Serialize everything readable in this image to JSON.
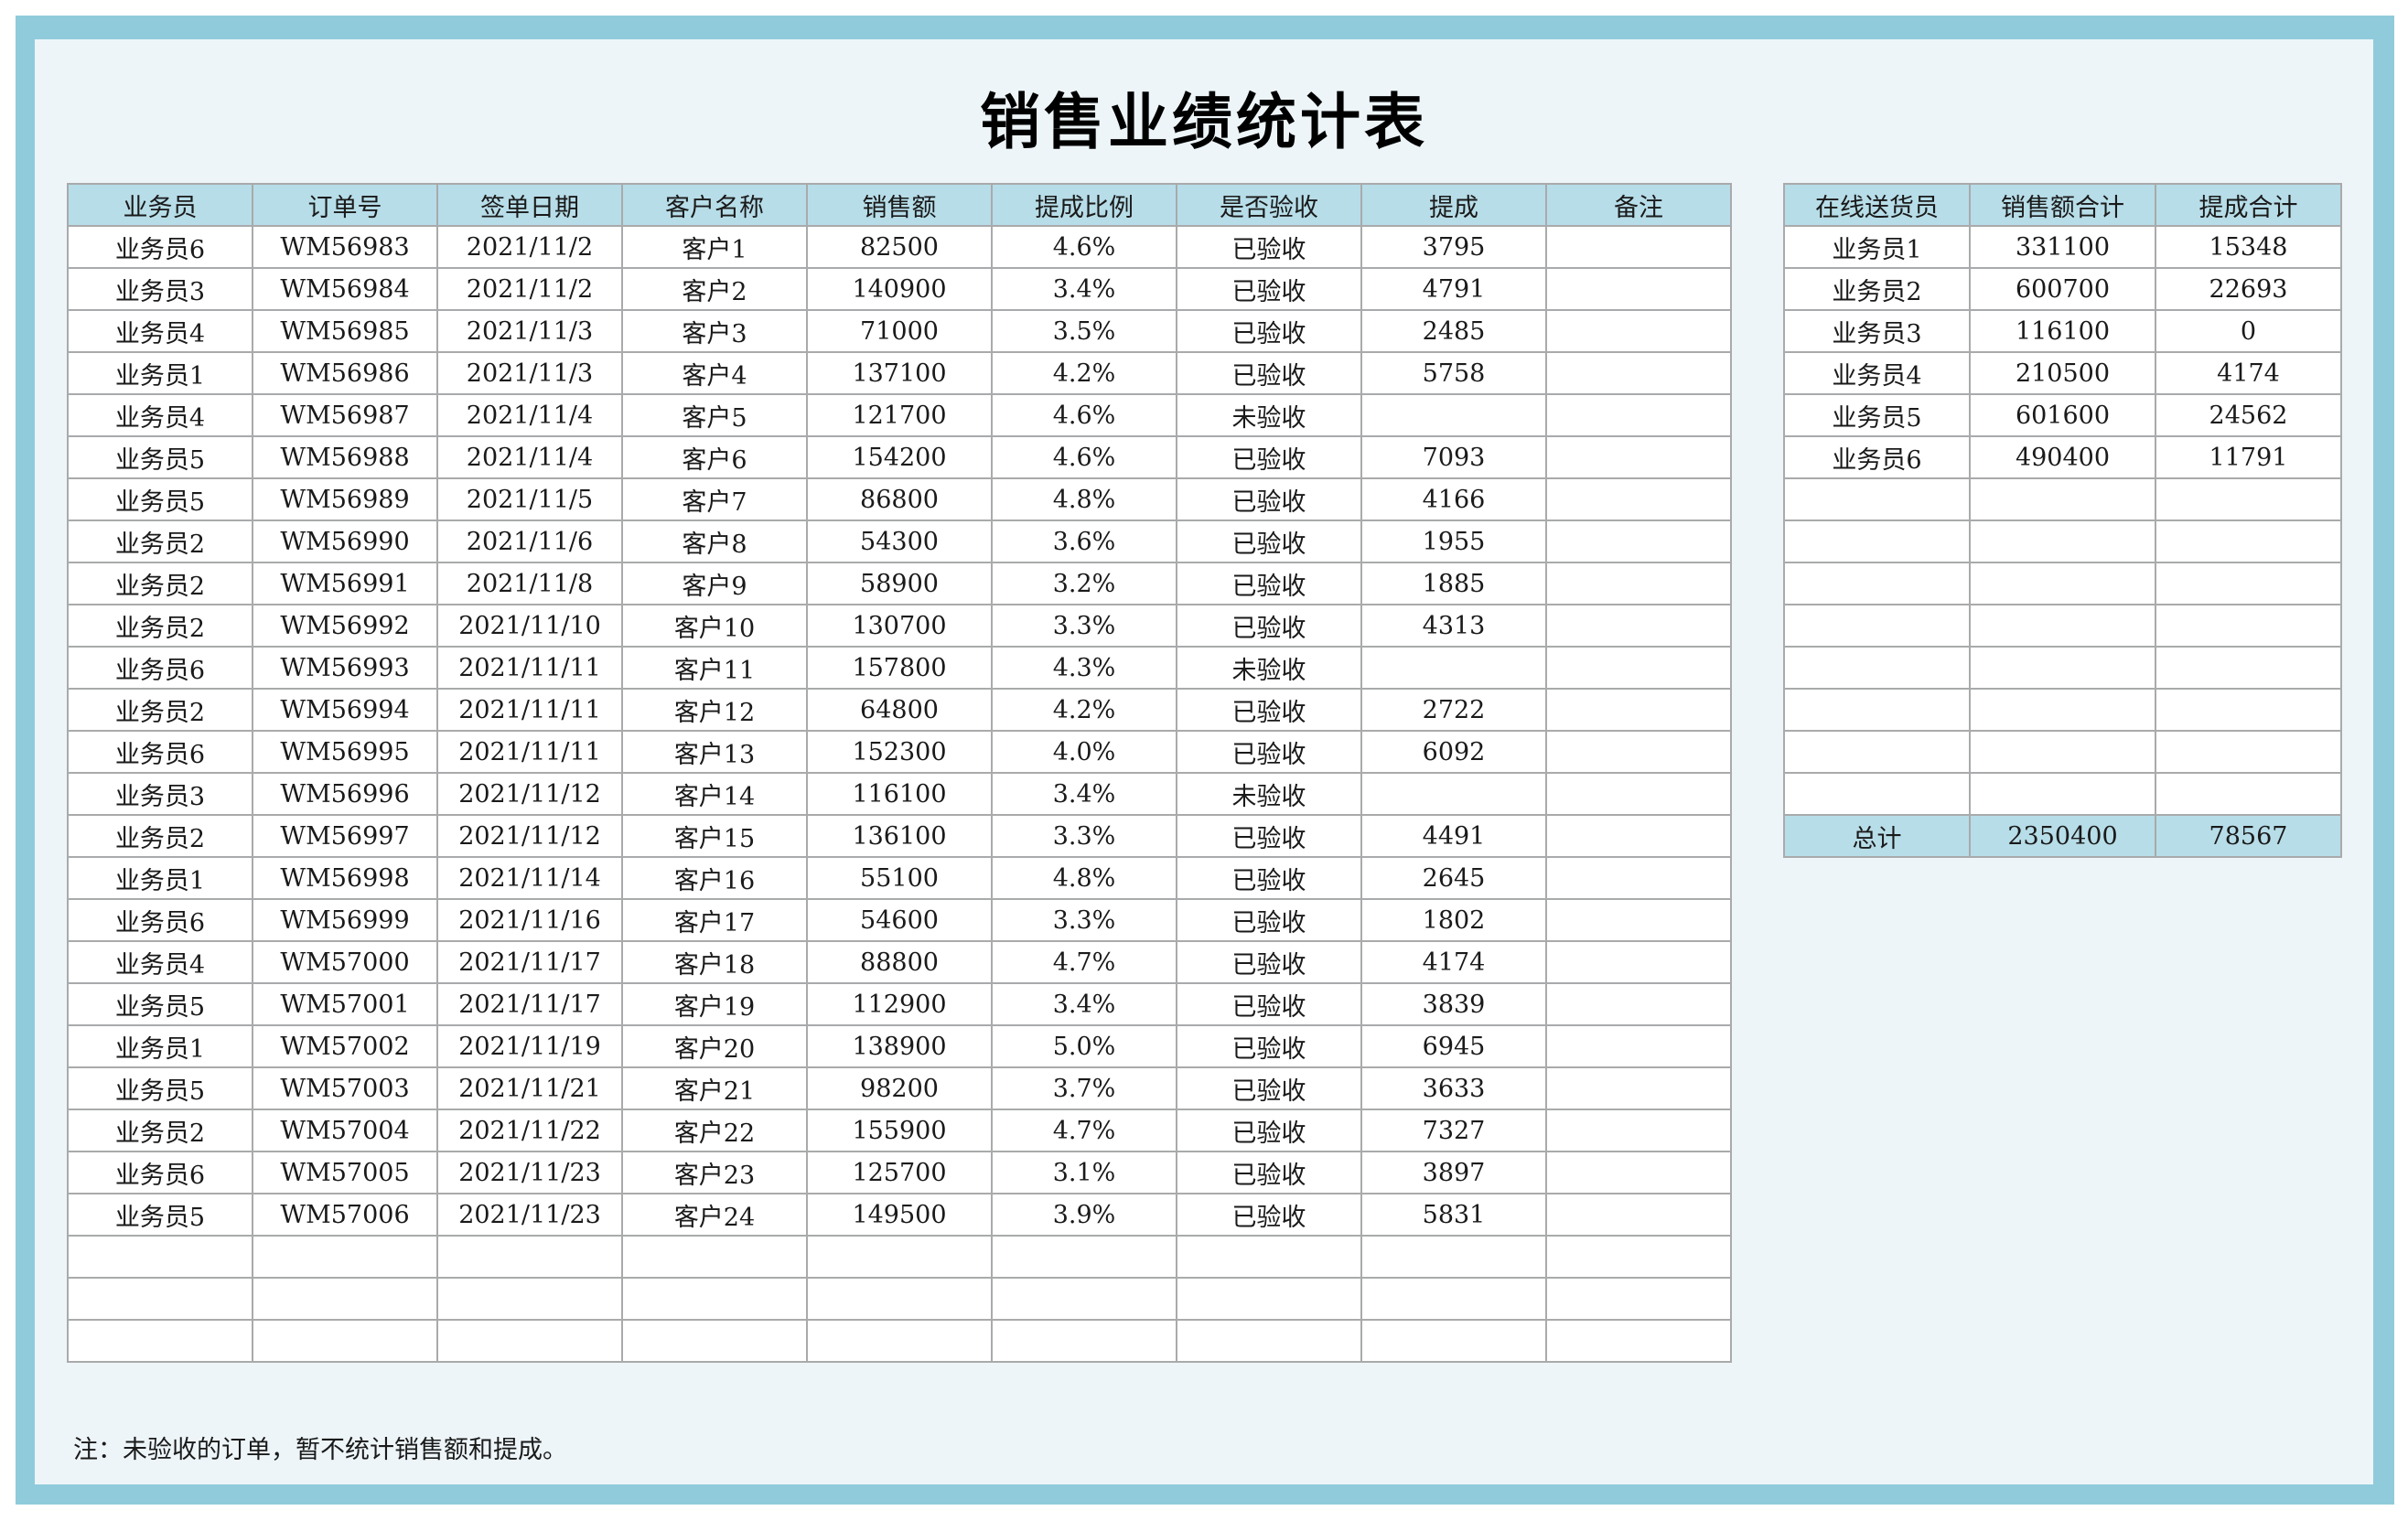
{
  "title": "销售业绩统计表",
  "main": {
    "headers": [
      "业务员",
      "订单号",
      "签单日期",
      "客户名称",
      "销售额",
      "提成比例",
      "是否验收",
      "提成",
      "备注"
    ],
    "rows": [
      [
        "业务员6",
        "WM56983",
        "2021/11/2",
        "客户1",
        "82500",
        "4.6%",
        "已验收",
        "3795",
        ""
      ],
      [
        "业务员3",
        "WM56984",
        "2021/11/2",
        "客户2",
        "140900",
        "3.4%",
        "已验收",
        "4791",
        ""
      ],
      [
        "业务员4",
        "WM56985",
        "2021/11/3",
        "客户3",
        "71000",
        "3.5%",
        "已验收",
        "2485",
        ""
      ],
      [
        "业务员1",
        "WM56986",
        "2021/11/3",
        "客户4",
        "137100",
        "4.2%",
        "已验收",
        "5758",
        ""
      ],
      [
        "业务员4",
        "WM56987",
        "2021/11/4",
        "客户5",
        "121700",
        "4.6%",
        "未验收",
        "",
        ""
      ],
      [
        "业务员5",
        "WM56988",
        "2021/11/4",
        "客户6",
        "154200",
        "4.6%",
        "已验收",
        "7093",
        ""
      ],
      [
        "业务员5",
        "WM56989",
        "2021/11/5",
        "客户7",
        "86800",
        "4.8%",
        "已验收",
        "4166",
        ""
      ],
      [
        "业务员2",
        "WM56990",
        "2021/11/6",
        "客户8",
        "54300",
        "3.6%",
        "已验收",
        "1955",
        ""
      ],
      [
        "业务员2",
        "WM56991",
        "2021/11/8",
        "客户9",
        "58900",
        "3.2%",
        "已验收",
        "1885",
        ""
      ],
      [
        "业务员2",
        "WM56992",
        "2021/11/10",
        "客户10",
        "130700",
        "3.3%",
        "已验收",
        "4313",
        ""
      ],
      [
        "业务员6",
        "WM56993",
        "2021/11/11",
        "客户11",
        "157800",
        "4.3%",
        "未验收",
        "",
        ""
      ],
      [
        "业务员2",
        "WM56994",
        "2021/11/11",
        "客户12",
        "64800",
        "4.2%",
        "已验收",
        "2722",
        ""
      ],
      [
        "业务员6",
        "WM56995",
        "2021/11/11",
        "客户13",
        "152300",
        "4.0%",
        "已验收",
        "6092",
        ""
      ],
      [
        "业务员3",
        "WM56996",
        "2021/11/12",
        "客户14",
        "116100",
        "3.4%",
        "未验收",
        "",
        ""
      ],
      [
        "业务员2",
        "WM56997",
        "2021/11/12",
        "客户15",
        "136100",
        "3.3%",
        "已验收",
        "4491",
        ""
      ],
      [
        "业务员1",
        "WM56998",
        "2021/11/14",
        "客户16",
        "55100",
        "4.8%",
        "已验收",
        "2645",
        ""
      ],
      [
        "业务员6",
        "WM56999",
        "2021/11/16",
        "客户17",
        "54600",
        "3.3%",
        "已验收",
        "1802",
        ""
      ],
      [
        "业务员4",
        "WM57000",
        "2021/11/17",
        "客户18",
        "88800",
        "4.7%",
        "已验收",
        "4174",
        ""
      ],
      [
        "业务员5",
        "WM57001",
        "2021/11/17",
        "客户19",
        "112900",
        "3.4%",
        "已验收",
        "3839",
        ""
      ],
      [
        "业务员1",
        "WM57002",
        "2021/11/19",
        "客户20",
        "138900",
        "5.0%",
        "已验收",
        "6945",
        ""
      ],
      [
        "业务员5",
        "WM57003",
        "2021/11/21",
        "客户21",
        "98200",
        "3.7%",
        "已验收",
        "3633",
        ""
      ],
      [
        "业务员2",
        "WM57004",
        "2021/11/22",
        "客户22",
        "155900",
        "4.7%",
        "已验收",
        "7327",
        ""
      ],
      [
        "业务员6",
        "WM57005",
        "2021/11/23",
        "客户23",
        "125700",
        "3.1%",
        "已验收",
        "3897",
        ""
      ],
      [
        "业务员5",
        "WM57006",
        "2021/11/23",
        "客户24",
        "149500",
        "3.9%",
        "已验收",
        "5831",
        ""
      ],
      [
        "",
        "",
        "",
        "",
        "",
        "",
        "",
        "",
        ""
      ],
      [
        "",
        "",
        "",
        "",
        "",
        "",
        "",
        "",
        ""
      ],
      [
        "",
        "",
        "",
        "",
        "",
        "",
        "",
        "",
        ""
      ]
    ]
  },
  "summary": {
    "headers": [
      "在线送货员",
      "销售额合计",
      "提成合计"
    ],
    "rows": [
      [
        "业务员1",
        "331100",
        "15348"
      ],
      [
        "业务员2",
        "600700",
        "22693"
      ],
      [
        "业务员3",
        "116100",
        "0"
      ],
      [
        "业务员4",
        "210500",
        "4174"
      ],
      [
        "业务员5",
        "601600",
        "24562"
      ],
      [
        "业务员6",
        "490400",
        "11791"
      ],
      [
        "",
        "",
        ""
      ],
      [
        "",
        "",
        ""
      ],
      [
        "",
        "",
        ""
      ],
      [
        "",
        "",
        ""
      ],
      [
        "",
        "",
        ""
      ],
      [
        "",
        "",
        ""
      ],
      [
        "",
        "",
        ""
      ],
      [
        "",
        "",
        ""
      ]
    ],
    "total": [
      "总计",
      "2350400",
      "78567"
    ]
  },
  "note": "注：未验收的订单，暂不统计销售额和提成。"
}
